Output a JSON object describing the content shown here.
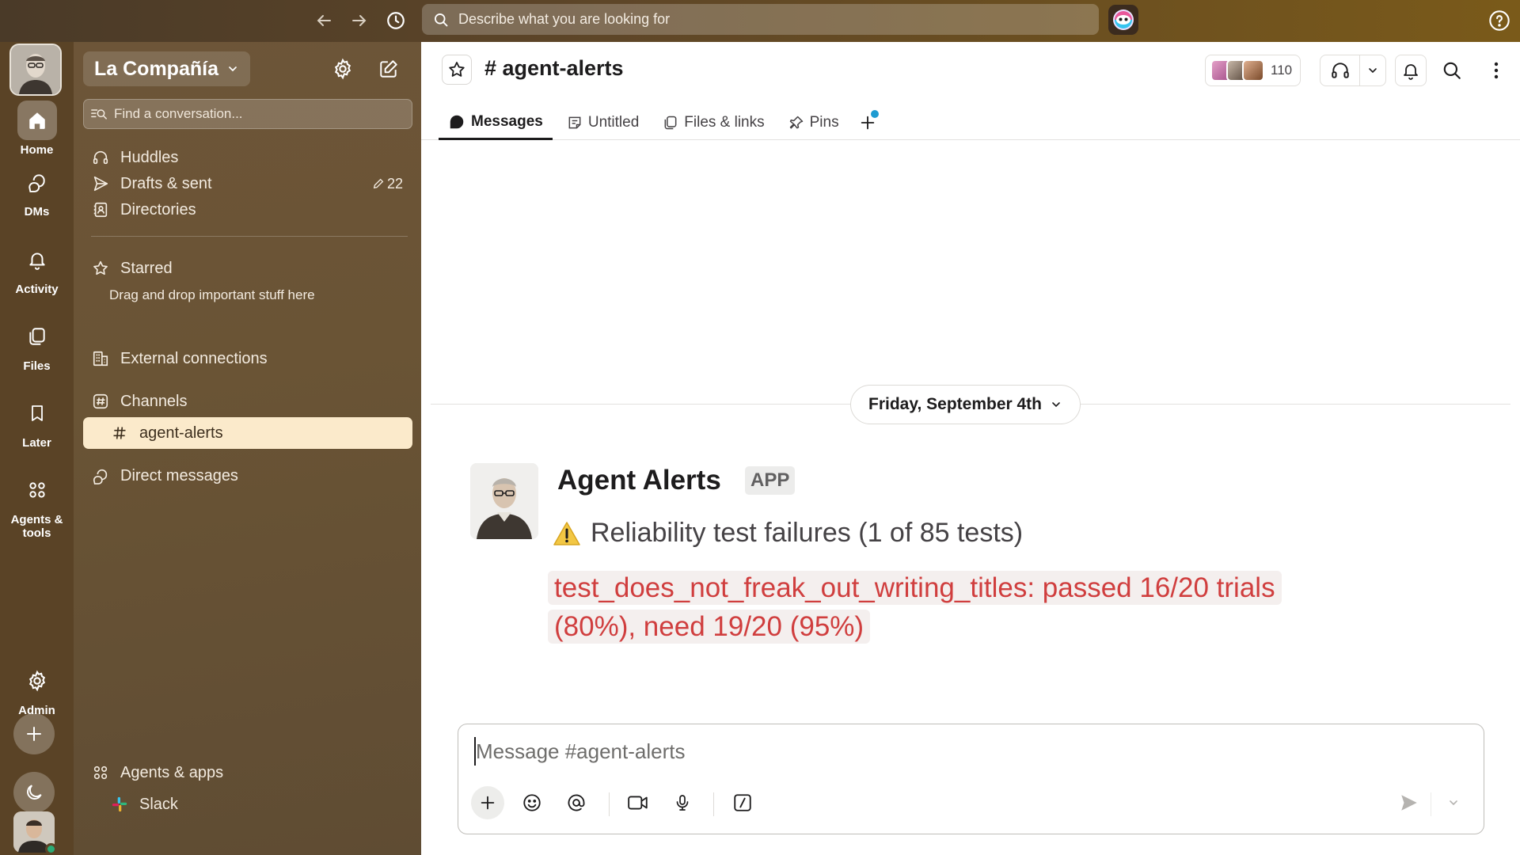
{
  "topbar": {
    "search_placeholder": "Describe what you are looking for"
  },
  "rail": {
    "items": [
      {
        "label": "Home"
      },
      {
        "label": "DMs"
      },
      {
        "label": "Activity"
      },
      {
        "label": "Files"
      },
      {
        "label": "Later"
      },
      {
        "label": "Agents & tools"
      },
      {
        "label": "Admin"
      }
    ]
  },
  "sidebar": {
    "workspace_name": "La Compañía",
    "find_placeholder": "Find a conversation...",
    "items": [
      {
        "label": "Huddles"
      },
      {
        "label": "Drafts & sent",
        "badge": "22"
      },
      {
        "label": "Directories"
      },
      {
        "label": "Starred"
      },
      {
        "label": "External connections"
      },
      {
        "label": "Channels"
      },
      {
        "label": "agent-alerts"
      },
      {
        "label": "Direct messages"
      },
      {
        "label": "Agents & apps"
      },
      {
        "label": "Slack"
      }
    ],
    "starred_hint": "Drag and drop important stuff here"
  },
  "channel": {
    "title": "# agent-alerts",
    "member_count": "110",
    "tabs": [
      {
        "label": "Messages"
      },
      {
        "label": "Untitled"
      },
      {
        "label": "Files & links"
      },
      {
        "label": "Pins"
      }
    ]
  },
  "messages": {
    "date_label": "Friday, September 4th",
    "author": "Agent Alerts",
    "badge": "APP",
    "line1": "Reliability test failures (1 of 85 tests)",
    "code": "test_does_not_freak_out_writing_titles: passed 16/20 trials (80%), need 19/20 (95%)"
  },
  "composer": {
    "placeholder": "Message #agent-alerts"
  },
  "colors": {
    "active_channel_bg": "#fbeacb",
    "code_text": "#d03e3e",
    "online": "#2bac76",
    "tab_dot": "#1d9bd1"
  }
}
